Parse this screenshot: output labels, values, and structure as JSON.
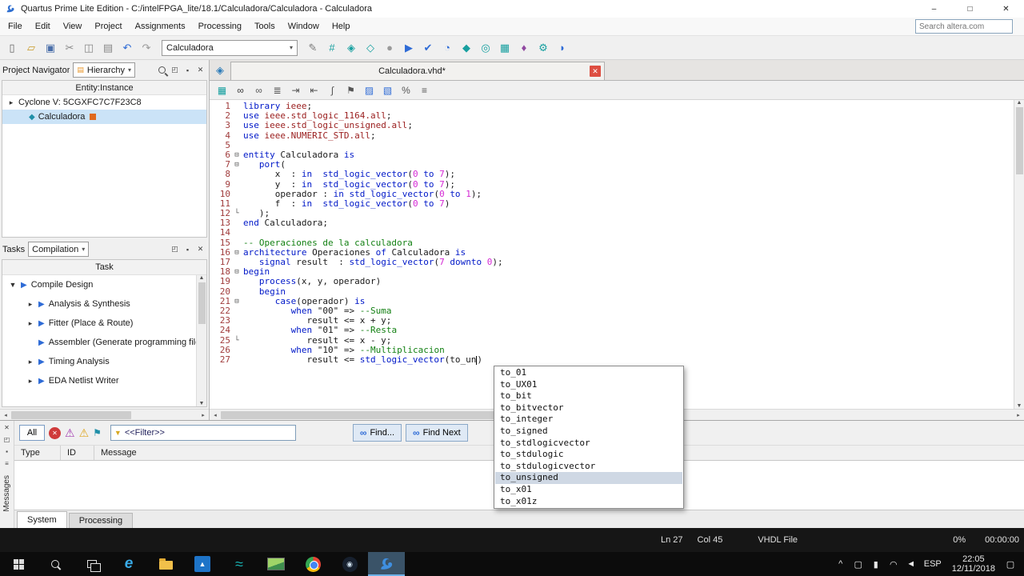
{
  "window": {
    "title": "Quartus Prime Lite Edition - C:/intelFPGA_lite/18.1/Calculadora/Calculadora - Calculadora",
    "minimize": "–",
    "maximize": "□",
    "close": "✕"
  },
  "menu": {
    "items": [
      "File",
      "Edit",
      "View",
      "Project",
      "Assignments",
      "Processing",
      "Tools",
      "Window",
      "Help"
    ],
    "search_placeholder": "Search altera.com"
  },
  "toolbar": {
    "project_select": "Calculadora",
    "icons_left": [
      {
        "name": "new-file-icon",
        "glyph": "▯",
        "color": "#666666"
      },
      {
        "name": "open-file-icon",
        "glyph": "▱",
        "color": "#c99a27"
      },
      {
        "name": "save-icon",
        "glyph": "▣",
        "color": "#4a6ea9"
      },
      {
        "name": "cut-icon",
        "glyph": "✂",
        "color": "#888888"
      },
      {
        "name": "copy-icon",
        "glyph": "◫",
        "color": "#888888"
      },
      {
        "name": "paste-icon",
        "glyph": "▤",
        "color": "#888888"
      },
      {
        "name": "undo-icon",
        "glyph": "↶",
        "color": "#2e6bd6"
      },
      {
        "name": "redo-icon",
        "glyph": "↷",
        "color": "#999999"
      }
    ],
    "icons_right": [
      {
        "name": "pencil-icon",
        "glyph": "✎",
        "color": "#777777"
      },
      {
        "name": "new-project-wizard-icon",
        "glyph": "#",
        "color": "#18a0a0"
      },
      {
        "name": "assignment-editor-icon",
        "glyph": "◈",
        "color": "#18a0a0"
      },
      {
        "name": "pin-planner-icon",
        "glyph": "◇",
        "color": "#18a0a0"
      },
      {
        "name": "stop-icon",
        "glyph": "●",
        "color": "#9a9a9a"
      },
      {
        "name": "start-compilation-icon",
        "glyph": "▶",
        "color": "#2e6bd6"
      },
      {
        "name": "start-analysis-icon",
        "glyph": "✔",
        "color": "#2e6bd6"
      },
      {
        "name": "timing-analyzer-icon",
        "glyph": "◔",
        "color": "#2e6bd6"
      },
      {
        "name": "netlist-viewer-icon",
        "glyph": "◆",
        "color": "#18a0a0"
      },
      {
        "name": "technology-map-icon",
        "glyph": "◎",
        "color": "#18a0a0"
      },
      {
        "name": "chip-planner-icon",
        "glyph": "▦",
        "color": "#18a0a0"
      },
      {
        "name": "design-partition-icon",
        "glyph": "♦",
        "color": "#9047a0"
      },
      {
        "name": "programmer-icon",
        "glyph": "⚙",
        "color": "#18a0a0"
      },
      {
        "name": "comment-bubble-icon",
        "glyph": "◗",
        "color": "#2e6bd6"
      }
    ]
  },
  "project_navigator": {
    "title": "Project Navigator",
    "mode": "Hierarchy",
    "header": "Entity:Instance",
    "header_icons": [
      {
        "name": "search-icon",
        "type": "mag"
      },
      {
        "name": "detach-icon",
        "glyph": "◰",
        "color": "#444444"
      },
      {
        "name": "pin-icon",
        "glyph": "▪",
        "color": "#444444"
      },
      {
        "name": "close-icon",
        "glyph": "✕",
        "color": "#444444"
      }
    ],
    "items": [
      {
        "label": "Cyclone V: 5CGXFC7C7F23C8",
        "level": 0,
        "arrow": true
      },
      {
        "label": "Calculadora",
        "level": 1,
        "icon": true,
        "selected": true,
        "badge": true
      }
    ]
  },
  "tasks": {
    "title": "Tasks",
    "mode": "Compilation",
    "header": "Task",
    "header_icons": [
      {
        "name": "detach-icon",
        "glyph": "◰",
        "color": "#444444"
      },
      {
        "name": "pin-icon",
        "glyph": "▪",
        "color": "#444444"
      },
      {
        "name": "close-icon",
        "glyph": "✕",
        "color": "#444444"
      }
    ],
    "items": [
      {
        "label": "Compile Design",
        "level": 0,
        "arrow": "▼",
        "play": true
      },
      {
        "label": "Analysis & Synthesis",
        "level": 1,
        "arrow": "▸",
        "play": true
      },
      {
        "label": "Fitter (Place & Route)",
        "level": 1,
        "arrow": "▸",
        "play": true
      },
      {
        "label": "Assembler (Generate programming files)",
        "level": 1,
        "arrow": "",
        "play": true
      },
      {
        "label": "Timing Analysis",
        "level": 1,
        "arrow": "▸",
        "play": true
      },
      {
        "label": "EDA Netlist Writer",
        "level": 1,
        "arrow": "▸",
        "play": true
      }
    ]
  },
  "editor": {
    "tab": "Calculadora.vhd*",
    "toolbar_icons": [
      {
        "name": "file-grid-icon",
        "glyph": "▦",
        "color": "#18a0a0"
      },
      {
        "name": "find-icon",
        "glyph": "∞",
        "color": "#333333"
      },
      {
        "name": "replace-icon",
        "glyph": "∞",
        "color": "#555555"
      },
      {
        "name": "goto-line-icon",
        "glyph": "≣",
        "color": "#555555"
      },
      {
        "name": "indent-icon",
        "glyph": "⇥",
        "color": "#555555"
      },
      {
        "name": "outdent-icon",
        "glyph": "⇤",
        "color": "#555555"
      },
      {
        "name": "attach-icon",
        "glyph": "∫",
        "color": "#555555"
      },
      {
        "name": "bookmark-icon",
        "glyph": "⚑",
        "color": "#555555"
      },
      {
        "name": "comment-icon",
        "glyph": "▨",
        "color": "#2e6bd6"
      },
      {
        "name": "uncomment-icon",
        "glyph": "▧",
        "color": "#2e6bd6"
      },
      {
        "name": "syntax-percent-icon",
        "glyph": "%",
        "color": "#555555"
      },
      {
        "name": "word-wrap-icon",
        "glyph": "≡",
        "color": "#555555"
      }
    ],
    "lines": [
      {
        "seg": [
          [
            "k",
            "library "
          ],
          [
            "m",
            "ieee"
          ],
          [
            "p",
            ";"
          ]
        ]
      },
      {
        "seg": [
          [
            "k",
            "use "
          ],
          [
            "m",
            "ieee.std_logic_1164.all"
          ],
          [
            "p",
            ";"
          ]
        ]
      },
      {
        "seg": [
          [
            "k",
            "use "
          ],
          [
            "m",
            "ieee.std_logic_unsigned.all"
          ],
          [
            "p",
            ";"
          ]
        ]
      },
      {
        "seg": [
          [
            "k",
            "use "
          ],
          [
            "m",
            "ieee.NUMERIC_STD.all"
          ],
          [
            "p",
            ";"
          ]
        ]
      },
      {
        "seg": []
      },
      {
        "fold": "box",
        "seg": [
          [
            "k",
            "entity "
          ],
          [
            "p",
            "Calculadora "
          ],
          [
            "k",
            "is"
          ]
        ]
      },
      {
        "fold": "box",
        "seg": [
          [
            "p",
            "   "
          ],
          [
            "k",
            "port"
          ],
          [
            "p",
            "("
          ]
        ]
      },
      {
        "seg": [
          [
            "p",
            "      x  : "
          ],
          [
            "k",
            "in"
          ],
          [
            "p",
            "  "
          ],
          [
            "t",
            "std_logic_vector"
          ],
          [
            "p",
            "("
          ],
          [
            "n",
            "0"
          ],
          [
            "p",
            " "
          ],
          [
            "k",
            "to"
          ],
          [
            "p",
            " "
          ],
          [
            "n",
            "7"
          ],
          [
            "p",
            ");"
          ]
        ]
      },
      {
        "seg": [
          [
            "p",
            "      y  : "
          ],
          [
            "k",
            "in"
          ],
          [
            "p",
            "  "
          ],
          [
            "t",
            "std_logic_vector"
          ],
          [
            "p",
            "("
          ],
          [
            "n",
            "0"
          ],
          [
            "p",
            " "
          ],
          [
            "k",
            "to"
          ],
          [
            "p",
            " "
          ],
          [
            "n",
            "7"
          ],
          [
            "p",
            ");"
          ]
        ]
      },
      {
        "seg": [
          [
            "p",
            "      operador : "
          ],
          [
            "k",
            "in"
          ],
          [
            "p",
            " "
          ],
          [
            "t",
            "std_logic_vector"
          ],
          [
            "p",
            "("
          ],
          [
            "n",
            "0"
          ],
          [
            "p",
            " "
          ],
          [
            "k",
            "to"
          ],
          [
            "p",
            " "
          ],
          [
            "n",
            "1"
          ],
          [
            "p",
            ");"
          ]
        ]
      },
      {
        "seg": [
          [
            "p",
            "      f  : "
          ],
          [
            "k",
            "in"
          ],
          [
            "p",
            "  "
          ],
          [
            "t",
            "std_logic_vector"
          ],
          [
            "p",
            "("
          ],
          [
            "n",
            "0"
          ],
          [
            "p",
            " "
          ],
          [
            "k",
            "to"
          ],
          [
            "p",
            " "
          ],
          [
            "n",
            "7"
          ],
          [
            "p",
            ")"
          ]
        ]
      },
      {
        "fold": "end",
        "seg": [
          [
            "p",
            "   );"
          ]
        ]
      },
      {
        "seg": [
          [
            "k",
            "end "
          ],
          [
            "p",
            "Calculadora;"
          ]
        ]
      },
      {
        "seg": []
      },
      {
        "seg": [
          [
            "c",
            "-- Operaciones de la calculadora"
          ]
        ]
      },
      {
        "fold": "box",
        "seg": [
          [
            "k",
            "architecture "
          ],
          [
            "p",
            "Operaciones "
          ],
          [
            "k",
            "of"
          ],
          [
            "p",
            " Calculadora "
          ],
          [
            "k",
            "is"
          ]
        ]
      },
      {
        "seg": [
          [
            "p",
            "   "
          ],
          [
            "k",
            "signal"
          ],
          [
            "p",
            " result  : "
          ],
          [
            "t",
            "std_logic_vector"
          ],
          [
            "p",
            "("
          ],
          [
            "n",
            "7"
          ],
          [
            "p",
            " "
          ],
          [
            "k",
            "downto"
          ],
          [
            "p",
            " "
          ],
          [
            "n",
            "0"
          ],
          [
            "p",
            ");"
          ]
        ]
      },
      {
        "fold": "box",
        "seg": [
          [
            "k",
            "begin"
          ]
        ]
      },
      {
        "seg": [
          [
            "p",
            "   "
          ],
          [
            "k",
            "process"
          ],
          [
            "p",
            "(x, y, operador)"
          ]
        ]
      },
      {
        "seg": [
          [
            "p",
            "   "
          ],
          [
            "k",
            "begin"
          ]
        ]
      },
      {
        "fold": "box",
        "seg": [
          [
            "p",
            "      "
          ],
          [
            "k",
            "case"
          ],
          [
            "p",
            "(operador) "
          ],
          [
            "k",
            "is"
          ]
        ]
      },
      {
        "seg": [
          [
            "p",
            "         "
          ],
          [
            "k",
            "when"
          ],
          [
            "p",
            " "
          ],
          [
            "s",
            "\"00\""
          ],
          [
            "p",
            " => "
          ],
          [
            "c",
            "--Suma"
          ]
        ]
      },
      {
        "seg": [
          [
            "p",
            "            result <= x + y;"
          ]
        ]
      },
      {
        "seg": [
          [
            "p",
            "         "
          ],
          [
            "k",
            "when"
          ],
          [
            "p",
            " "
          ],
          [
            "s",
            "\"01\""
          ],
          [
            "p",
            " => "
          ],
          [
            "c",
            "--Resta"
          ]
        ]
      },
      {
        "fold": "end",
        "seg": [
          [
            "p",
            "            result <= x - y;"
          ]
        ]
      },
      {
        "seg": [
          [
            "p",
            "         "
          ],
          [
            "k",
            "when"
          ],
          [
            "p",
            " "
          ],
          [
            "s",
            "\"10\""
          ],
          [
            "p",
            " => "
          ],
          [
            "c",
            "--Multiplicacion"
          ]
        ]
      },
      {
        "seg": [
          [
            "p",
            "            result <= "
          ],
          [
            "t",
            "std_logic_vector"
          ],
          [
            "p",
            "(to_un"
          ],
          [
            "caret",
            ""
          ],
          [
            "p",
            ")"
          ]
        ]
      }
    ],
    "autocomplete": {
      "items": [
        "to_01",
        "to_UX01",
        "to_bit",
        "to_bitvector",
        "to_integer",
        "to_signed",
        "to_stdlogicvector",
        "to_stdulogic",
        "to_stdulogicvector",
        "to_unsigned",
        "to_x01",
        "to_x01z"
      ],
      "selected": "to_unsigned"
    }
  },
  "messages": {
    "vertical_label": "Messages",
    "all_button": "All",
    "filter_value": "<<Filter>>",
    "find_button": "Find...",
    "find_next_button": "Find Next",
    "severity_icons": [
      {
        "name": "error-icon",
        "cls": "sev-error",
        "glyph": "✕"
      },
      {
        "name": "critical-warning-icon",
        "cls": "sev-crit",
        "glyph": "⚠"
      },
      {
        "name": "warning-icon",
        "cls": "sev-warn",
        "glyph": "⚠"
      },
      {
        "name": "info-icon",
        "cls": "sev-info",
        "glyph": "⚑"
      }
    ],
    "strip_icons": [
      {
        "name": "close-icon",
        "glyph": "✕",
        "color": "#444444"
      },
      {
        "name": "detach-icon",
        "glyph": "◰",
        "color": "#444444"
      },
      {
        "name": "pin-icon",
        "glyph": "▪",
        "color": "#444444"
      },
      {
        "name": "menu-icon",
        "glyph": "≡",
        "color": "#444444"
      }
    ],
    "columns": [
      "Type",
      "ID",
      "Message"
    ],
    "tabs": [
      "System",
      "Processing"
    ],
    "active_tab": "System"
  },
  "statusbar": {
    "line": "Ln 27",
    "column": "Col 45",
    "file_type": "VHDL File",
    "progress": "0%",
    "elapsed": "00:00:00"
  },
  "taskbar": {
    "apps": [
      {
        "name": "start-button",
        "type": "win"
      },
      {
        "name": "search-button",
        "type": "mag"
      },
      {
        "name": "task-view-button",
        "type": "taskview"
      },
      {
        "name": "edge-icon",
        "type": "glyph",
        "glyph": "e",
        "color": "#39abe8",
        "size": 19,
        "style": "italic"
      },
      {
        "name": "file-explorer-icon",
        "type": "folder"
      },
      {
        "name": "photos-icon",
        "type": "tile",
        "bg": "#1e74c8",
        "glyph": "▲",
        "color": "#ffffff"
      },
      {
        "name": "store-icon",
        "type": "glyph",
        "glyph": "≈",
        "color": "#18b0b0",
        "size": 18
      },
      {
        "name": "image-preview-icon",
        "type": "thumb"
      },
      {
        "name": "chrome-icon",
        "type": "chrome"
      },
      {
        "name": "steam-icon",
        "type": "steam"
      },
      {
        "name": "quartus-icon",
        "type": "swan",
        "active": true
      }
    ],
    "tray": {
      "icons": [
        {
          "name": "hidden-icons-chevron",
          "glyph": "^"
        },
        {
          "name": "pc-status-icon",
          "glyph": "▢"
        },
        {
          "name": "battery-icon",
          "glyph": "▮"
        },
        {
          "name": "wifi-icon",
          "glyph": "◠"
        },
        {
          "name": "volume-icon",
          "glyph": "◄"
        }
      ],
      "lang": "ESP",
      "time": "22:05",
      "date": "12/11/2018"
    }
  }
}
